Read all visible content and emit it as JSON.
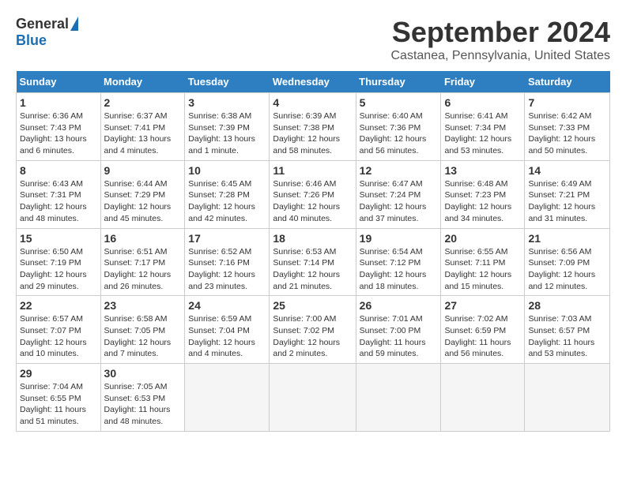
{
  "header": {
    "logo_general": "General",
    "logo_blue": "Blue",
    "month_title": "September 2024",
    "location": "Castanea, Pennsylvania, United States"
  },
  "calendar": {
    "days_of_week": [
      "Sunday",
      "Monday",
      "Tuesday",
      "Wednesday",
      "Thursday",
      "Friday",
      "Saturday"
    ],
    "weeks": [
      [
        {
          "day": 1,
          "sunrise": "6:36 AM",
          "sunset": "7:43 PM",
          "daylight": "13 hours and 6 minutes."
        },
        {
          "day": 2,
          "sunrise": "6:37 AM",
          "sunset": "7:41 PM",
          "daylight": "13 hours and 4 minutes."
        },
        {
          "day": 3,
          "sunrise": "6:38 AM",
          "sunset": "7:39 PM",
          "daylight": "13 hours and 1 minute."
        },
        {
          "day": 4,
          "sunrise": "6:39 AM",
          "sunset": "7:38 PM",
          "daylight": "12 hours and 58 minutes."
        },
        {
          "day": 5,
          "sunrise": "6:40 AM",
          "sunset": "7:36 PM",
          "daylight": "12 hours and 56 minutes."
        },
        {
          "day": 6,
          "sunrise": "6:41 AM",
          "sunset": "7:34 PM",
          "daylight": "12 hours and 53 minutes."
        },
        {
          "day": 7,
          "sunrise": "6:42 AM",
          "sunset": "7:33 PM",
          "daylight": "12 hours and 50 minutes."
        }
      ],
      [
        {
          "day": 8,
          "sunrise": "6:43 AM",
          "sunset": "7:31 PM",
          "daylight": "12 hours and 48 minutes."
        },
        {
          "day": 9,
          "sunrise": "6:44 AM",
          "sunset": "7:29 PM",
          "daylight": "12 hours and 45 minutes."
        },
        {
          "day": 10,
          "sunrise": "6:45 AM",
          "sunset": "7:28 PM",
          "daylight": "12 hours and 42 minutes."
        },
        {
          "day": 11,
          "sunrise": "6:46 AM",
          "sunset": "7:26 PM",
          "daylight": "12 hours and 40 minutes."
        },
        {
          "day": 12,
          "sunrise": "6:47 AM",
          "sunset": "7:24 PM",
          "daylight": "12 hours and 37 minutes."
        },
        {
          "day": 13,
          "sunrise": "6:48 AM",
          "sunset": "7:23 PM",
          "daylight": "12 hours and 34 minutes."
        },
        {
          "day": 14,
          "sunrise": "6:49 AM",
          "sunset": "7:21 PM",
          "daylight": "12 hours and 31 minutes."
        }
      ],
      [
        {
          "day": 15,
          "sunrise": "6:50 AM",
          "sunset": "7:19 PM",
          "daylight": "12 hours and 29 minutes."
        },
        {
          "day": 16,
          "sunrise": "6:51 AM",
          "sunset": "7:17 PM",
          "daylight": "12 hours and 26 minutes."
        },
        {
          "day": 17,
          "sunrise": "6:52 AM",
          "sunset": "7:16 PM",
          "daylight": "12 hours and 23 minutes."
        },
        {
          "day": 18,
          "sunrise": "6:53 AM",
          "sunset": "7:14 PM",
          "daylight": "12 hours and 21 minutes."
        },
        {
          "day": 19,
          "sunrise": "6:54 AM",
          "sunset": "7:12 PM",
          "daylight": "12 hours and 18 minutes."
        },
        {
          "day": 20,
          "sunrise": "6:55 AM",
          "sunset": "7:11 PM",
          "daylight": "12 hours and 15 minutes."
        },
        {
          "day": 21,
          "sunrise": "6:56 AM",
          "sunset": "7:09 PM",
          "daylight": "12 hours and 12 minutes."
        }
      ],
      [
        {
          "day": 22,
          "sunrise": "6:57 AM",
          "sunset": "7:07 PM",
          "daylight": "12 hours and 10 minutes."
        },
        {
          "day": 23,
          "sunrise": "6:58 AM",
          "sunset": "7:05 PM",
          "daylight": "12 hours and 7 minutes."
        },
        {
          "day": 24,
          "sunrise": "6:59 AM",
          "sunset": "7:04 PM",
          "daylight": "12 hours and 4 minutes."
        },
        {
          "day": 25,
          "sunrise": "7:00 AM",
          "sunset": "7:02 PM",
          "daylight": "12 hours and 2 minutes."
        },
        {
          "day": 26,
          "sunrise": "7:01 AM",
          "sunset": "7:00 PM",
          "daylight": "11 hours and 59 minutes."
        },
        {
          "day": 27,
          "sunrise": "7:02 AM",
          "sunset": "6:59 PM",
          "daylight": "11 hours and 56 minutes."
        },
        {
          "day": 28,
          "sunrise": "7:03 AM",
          "sunset": "6:57 PM",
          "daylight": "11 hours and 53 minutes."
        }
      ],
      [
        {
          "day": 29,
          "sunrise": "7:04 AM",
          "sunset": "6:55 PM",
          "daylight": "11 hours and 51 minutes."
        },
        {
          "day": 30,
          "sunrise": "7:05 AM",
          "sunset": "6:53 PM",
          "daylight": "11 hours and 48 minutes."
        },
        null,
        null,
        null,
        null,
        null
      ]
    ]
  }
}
